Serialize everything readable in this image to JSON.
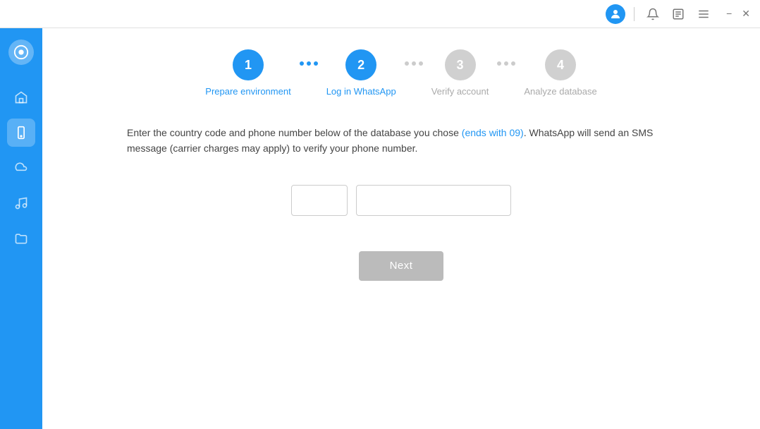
{
  "titlebar": {
    "avatar_icon": "👤",
    "bell_icon": "🔔",
    "note_icon": "📋",
    "menu_icon": "☰",
    "minimize_icon": "−",
    "close_icon": "✕"
  },
  "sidebar": {
    "logo_title": "App Logo",
    "items": [
      {
        "name": "home",
        "icon": "⌂",
        "active": false
      },
      {
        "name": "device",
        "icon": "📱",
        "active": true
      },
      {
        "name": "cloud",
        "icon": "☁",
        "active": false
      },
      {
        "name": "music",
        "icon": "♫",
        "active": false
      },
      {
        "name": "folder",
        "icon": "📁",
        "active": false
      }
    ]
  },
  "steps": [
    {
      "number": "1",
      "label": "Prepare environment",
      "state": "completed"
    },
    {
      "number": "2",
      "label": "Log in WhatsApp",
      "state": "active"
    },
    {
      "number": "3",
      "label": "Verify account",
      "state": "inactive"
    },
    {
      "number": "4",
      "label": "Analyze database",
      "state": "inactive"
    }
  ],
  "description": {
    "main_text": "Enter the country code and phone number below of the database you chose ",
    "link_text": "(ends with 09)",
    "rest_text": ". WhatsApp will send an SMS message (carrier charges may apply) to verify your phone number."
  },
  "form": {
    "country_code_placeholder": "",
    "phone_placeholder": "",
    "plus_sign": "+"
  },
  "buttons": {
    "next_label": "Next"
  }
}
